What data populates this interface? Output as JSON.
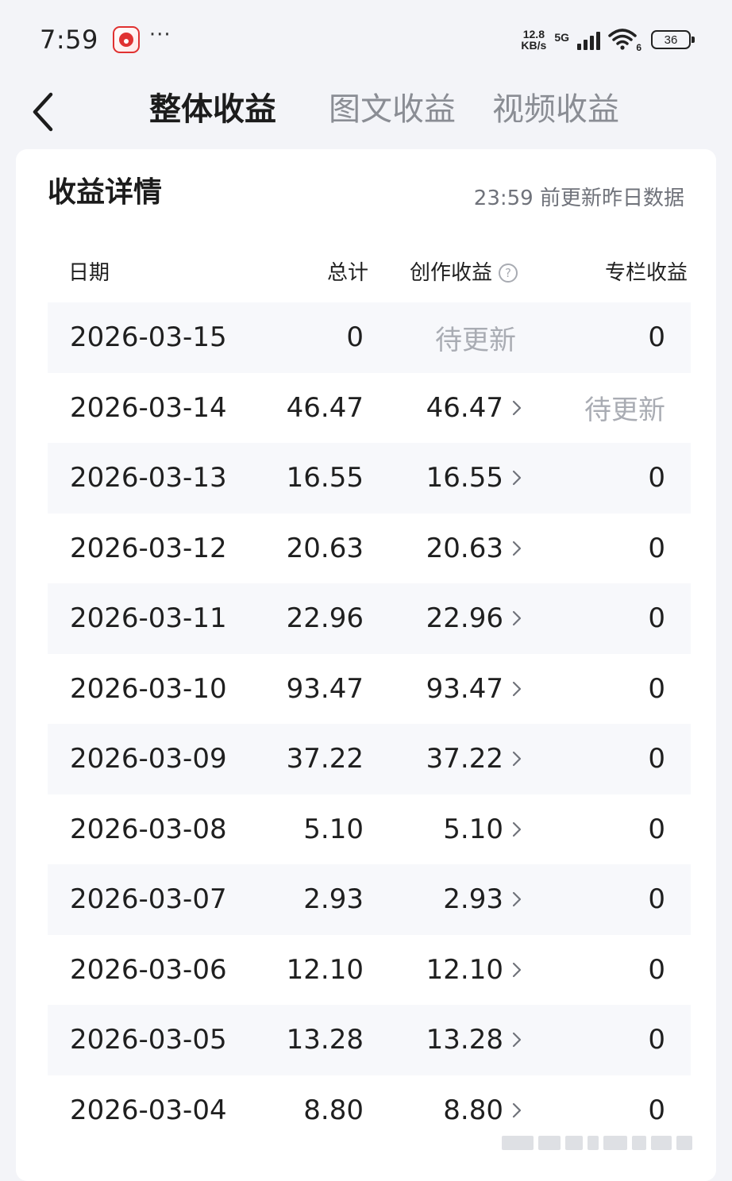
{
  "status_bar": {
    "time": "7:59",
    "network_speed_value": "12.8",
    "network_speed_unit": "KB/s",
    "network_type": "5G",
    "wifi_level": "6",
    "battery": "36",
    "icons": [
      "app-notification-icon",
      "more-dots-icon",
      "cellular-signal-icon",
      "wifi-icon",
      "battery-icon"
    ]
  },
  "nav": {
    "back_icon": "chevron-left-icon",
    "tabs": [
      {
        "label": "整体收益",
        "active": true
      },
      {
        "label": "图文收益",
        "active": false
      },
      {
        "label": "视频收益",
        "active": false
      }
    ]
  },
  "card": {
    "title": "收益详情",
    "update_note": "23:59 前更新昨日数据",
    "columns": {
      "date": "日期",
      "total": "总计",
      "creation": "创作收益",
      "creation_help_icon": "question-circle-icon",
      "column": "专栏收益"
    },
    "rows": [
      {
        "date": "2026-03-15",
        "total": "0",
        "creation": "待更新",
        "column": "0"
      },
      {
        "date": "2026-03-14",
        "total": "46.47",
        "creation": "46.47",
        "column": "待更新"
      },
      {
        "date": "2026-03-13",
        "total": "16.55",
        "creation": "16.55",
        "column": "0"
      },
      {
        "date": "2026-03-12",
        "total": "20.63",
        "creation": "20.63",
        "column": "0"
      },
      {
        "date": "2026-03-11",
        "total": "22.96",
        "creation": "22.96",
        "column": "0"
      },
      {
        "date": "2026-03-10",
        "total": "93.47",
        "creation": "93.47",
        "column": "0"
      },
      {
        "date": "2026-03-09",
        "total": "37.22",
        "creation": "37.22",
        "column": "0"
      },
      {
        "date": "2026-03-08",
        "total": "5.10",
        "creation": "5.10",
        "column": "0"
      },
      {
        "date": "2026-03-07",
        "total": "2.93",
        "creation": "2.93",
        "column": "0"
      },
      {
        "date": "2026-03-06",
        "total": "12.10",
        "creation": "12.10",
        "column": "0"
      },
      {
        "date": "2026-03-05",
        "total": "13.28",
        "creation": "13.28",
        "column": "0"
      },
      {
        "date": "2026-03-04",
        "total": "8.80",
        "creation": "8.80",
        "column": "0"
      }
    ],
    "pending_label": "待更新"
  },
  "colors": {
    "page_background": "#f3f4f8",
    "card_background": "#ffffff",
    "stripe": "#f7f8fb",
    "text_primary": "#1f1f1f",
    "text_inactive_tab": "#8a8d94",
    "text_pending": "#a9acb3"
  }
}
